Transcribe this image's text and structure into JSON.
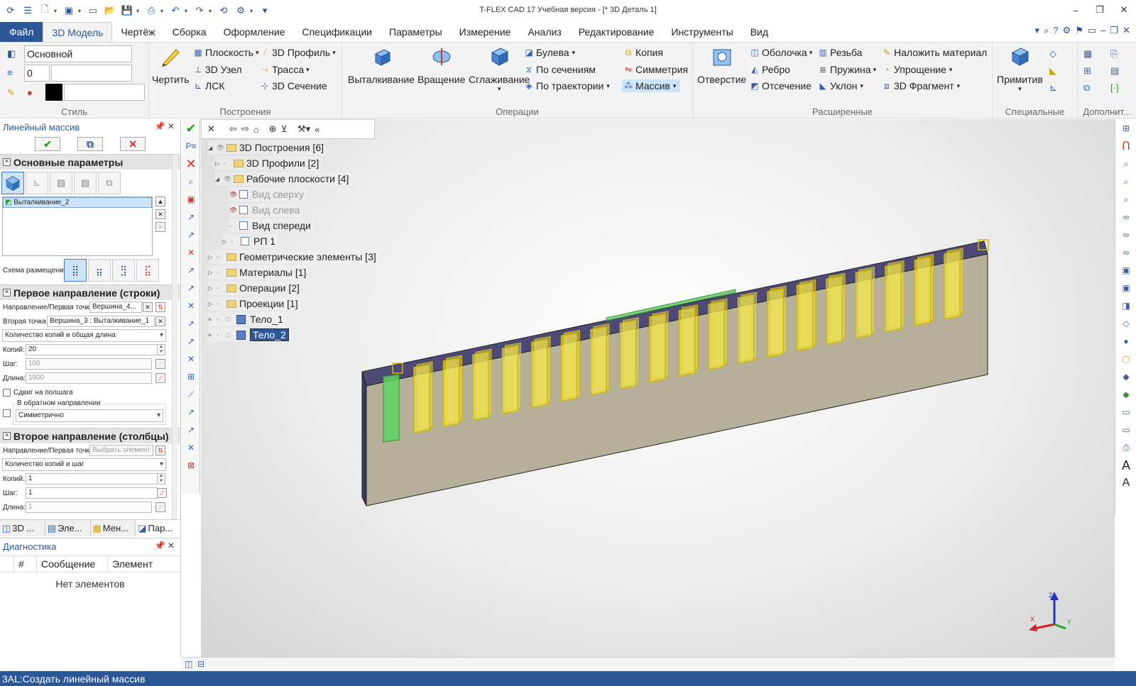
{
  "app": {
    "title": "T-FLEX CAD 17 Учебная версия - [* 3D Деталь 1]"
  },
  "menu": {
    "file": "Файл",
    "tabs": [
      "3D Модель",
      "Чертёж",
      "Сборка",
      "Оформление",
      "Спецификации",
      "Параметры",
      "Измерение",
      "Анализ",
      "Редактирование",
      "Инструменты",
      "Вид"
    ]
  },
  "ribbon": {
    "style": {
      "label": "Стиль",
      "layer": "Основной",
      "level": "0"
    },
    "build": {
      "label": "Построения",
      "draw": "Чертить",
      "plane": "Плоскость",
      "node": "3D Узел",
      "lsk": "ЛСК",
      "profile": "3D Профиль",
      "path": "Трасса",
      "section": "3D Сечение"
    },
    "ops": {
      "label": "Операции",
      "extrude": "Выталкивание",
      "rotate": "Вращение",
      "loft": "Сглаживание",
      "boolean": "Булева",
      "sections": "По сечениям",
      "traj": "По траектории",
      "copy": "Копия",
      "symmetry": "Симметрия",
      "array": "Массив"
    },
    "ext": {
      "label": "Расширенные",
      "hole": "Отверстие",
      "shell": "Оболочка",
      "rib": "Ребро",
      "cut": "Отсечение",
      "thread": "Резьба",
      "spring": "Пружина",
      "slope": "Уклон",
      "material": "Наложить материал",
      "simplify": "Упрощение",
      "fragment": "3D Фрагмент"
    },
    "spec": {
      "label": "Специальные",
      "primitive": "Примитив"
    },
    "extra": {
      "label": "Дополнит..."
    }
  },
  "panel": {
    "title": "Линейный массив",
    "main_section": "Основные параметры",
    "selected_op": "Выталкивание_2",
    "layout_scheme": "Схема размещения:",
    "dir1": {
      "header": "Первое направление (строки)",
      "dir_label": "Направление/Первая точка:",
      "dir_value": "Вершина_4...",
      "second_label": "Вторая точка:",
      "second_value": "Вершина_3 : Выталкивание_1",
      "mode": "Количество копий и общая длина",
      "copies_label": "Копий:",
      "copies": "20",
      "step_label": "Шаг:",
      "step": "100",
      "length_label": "Длина:",
      "length": "1900",
      "halfstep": "Сдвиг на полшага",
      "reverse": "В обратном направлении",
      "symmetric": "Симметрично"
    },
    "dir2": {
      "header": "Второе направление (столбцы)",
      "dir_label": "Направление/Первая точка:",
      "dir_placeholder": "Выбрать элемент",
      "mode": "Количество копий и шаг",
      "copies_label": "Копий:",
      "copies": "1",
      "step_label": "Шаг:",
      "step": "1",
      "length_label": "Длина:",
      "length": "1"
    },
    "tabs": [
      "3D ...",
      "Эле...",
      "Мен...",
      "Пар..."
    ]
  },
  "diagnostics": {
    "title": "Диагностика",
    "cols": [
      "#",
      "Сообщение",
      "Элемент"
    ],
    "empty": "Нет элементов"
  },
  "tree": {
    "items": [
      {
        "label": "3D Построения [6]"
      },
      {
        "label": "3D Профили [2]"
      },
      {
        "label": "Рабочие плоскости [4]"
      },
      {
        "label": "Вид сверху"
      },
      {
        "label": "Вид слева"
      },
      {
        "label": "Вид спереди"
      },
      {
        "label": "РП 1"
      },
      {
        "label": "Геометрические элементы [3]"
      },
      {
        "label": "Материалы [1]"
      },
      {
        "label": "Операции [2]"
      },
      {
        "label": "Проекции [1]"
      },
      {
        "label": "Тело_1"
      },
      {
        "label": "Тело_2"
      }
    ]
  },
  "axes": {
    "x": "X",
    "y": "Y",
    "z": "Z"
  },
  "status": "3AL:Создать линейный массив",
  "colors": {
    "accent": "#2b5797",
    "highlight": "#f5e84a",
    "green": "#5fd35f",
    "plate": "#b6b09b"
  }
}
